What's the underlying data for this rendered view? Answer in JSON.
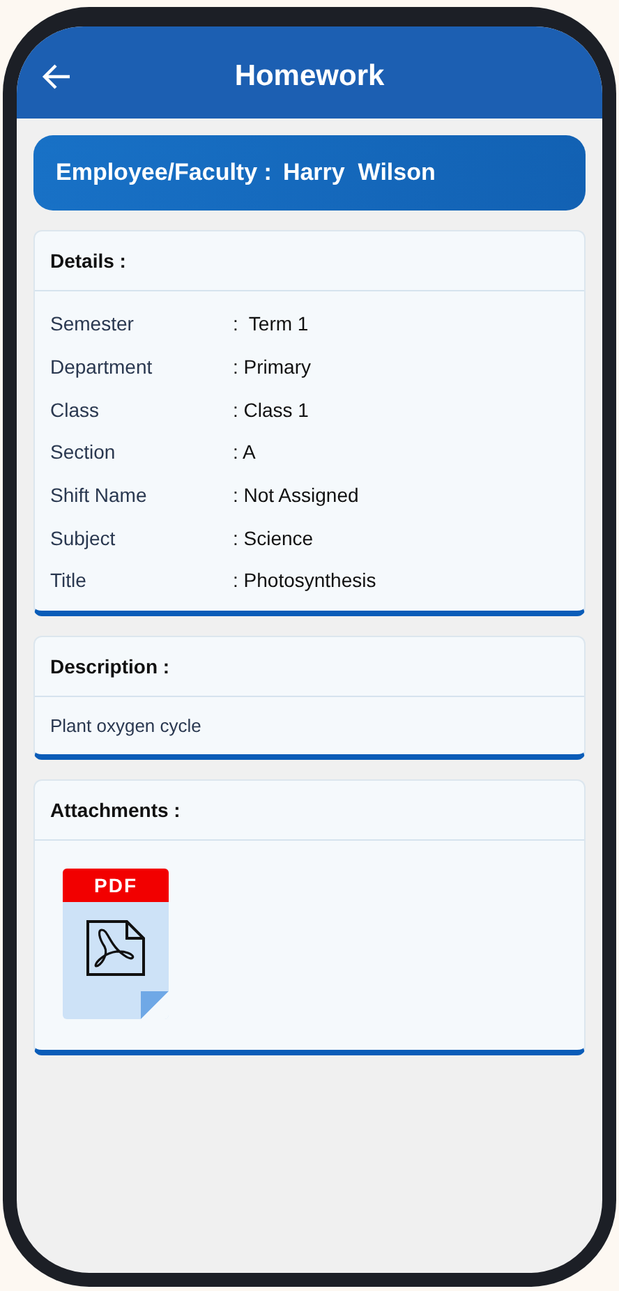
{
  "app_bar": {
    "title": "Homework"
  },
  "banner": {
    "label": "Employee/Faculty :",
    "value": "Harry  Wilson"
  },
  "details": {
    "heading": "Details :",
    "rows": [
      {
        "label": "Semester",
        "value": ":  Term 1"
      },
      {
        "label": "Department",
        "value": ": Primary"
      },
      {
        "label": "Class",
        "value": ": Class 1"
      },
      {
        "label": "Section",
        "value": ": A"
      },
      {
        "label": "Shift Name",
        "value": ": Not Assigned"
      },
      {
        "label": "Subject",
        "value": ": Science"
      },
      {
        "label": "Title",
        "value": ": Photosynthesis"
      }
    ]
  },
  "description": {
    "heading": "Description :",
    "text": "Plant oxygen cycle"
  },
  "attachments": {
    "heading": "Attachments :",
    "files": [
      {
        "kind": "pdf",
        "label": "PDF"
      }
    ]
  }
}
